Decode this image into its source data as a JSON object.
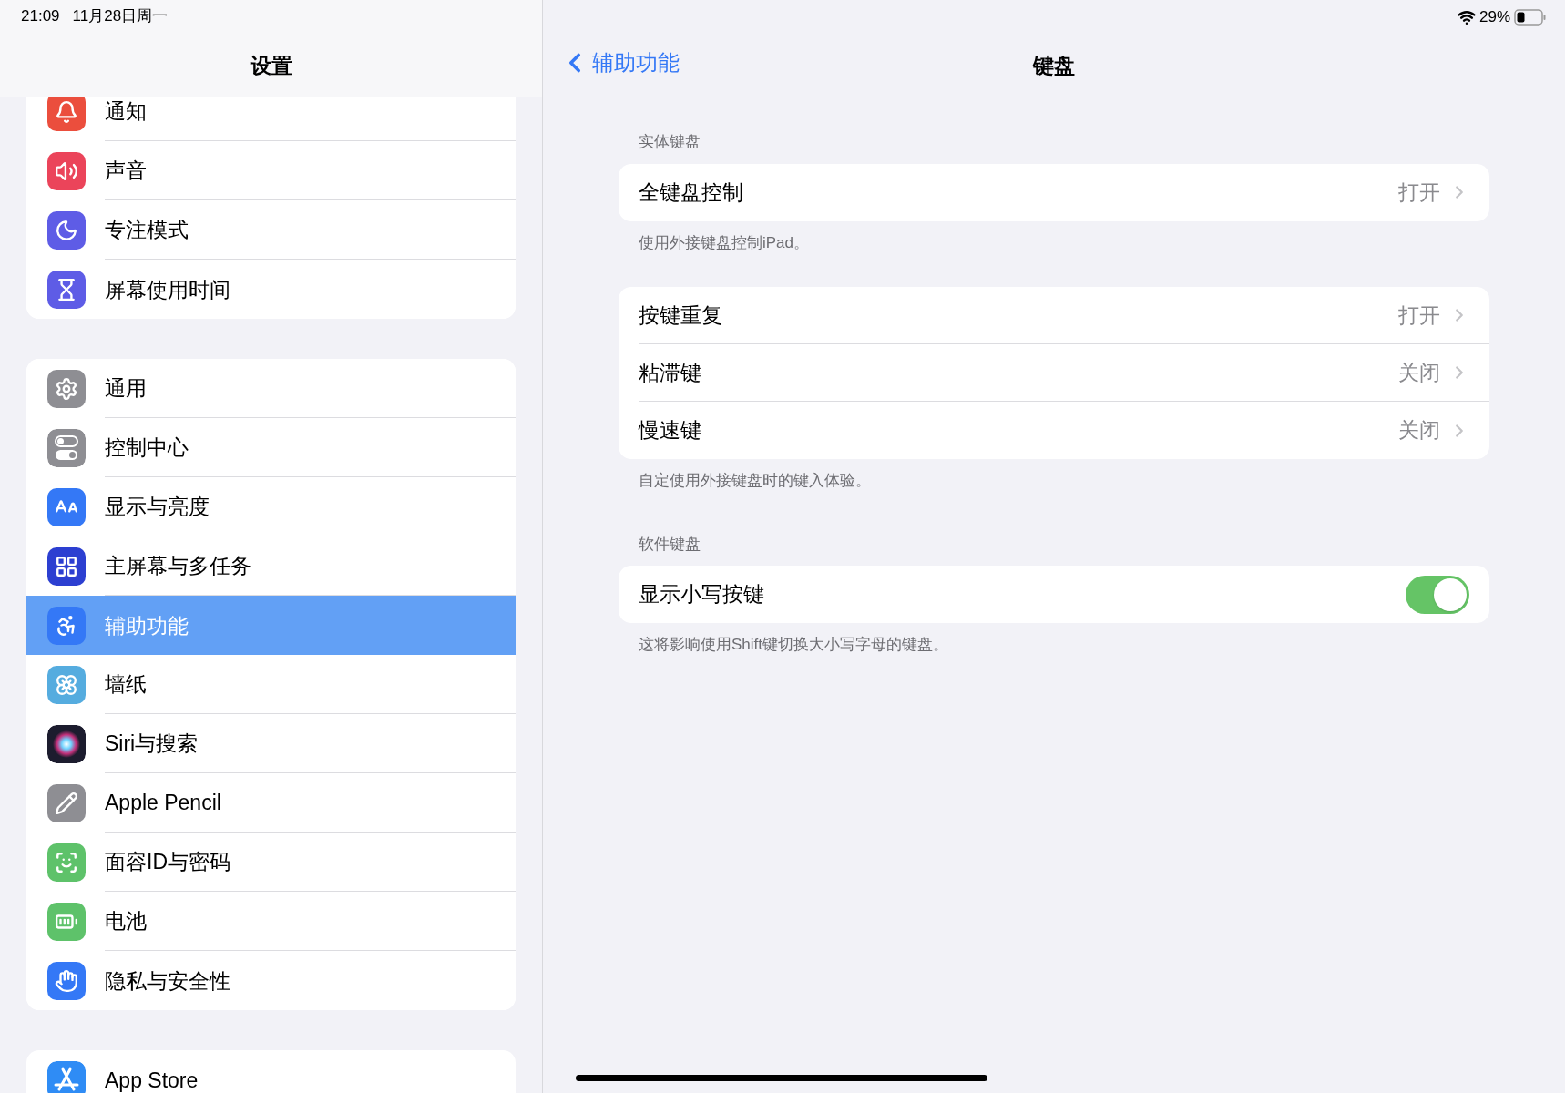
{
  "status_bar": {
    "time": "21:09",
    "date": "11月28日周一",
    "battery": "29%"
  },
  "sidebar": {
    "title": "设置",
    "groups": [
      {
        "items": [
          {
            "kind": "bell",
            "label": "通知",
            "color": "#eb4e3d",
            "selected": false
          },
          {
            "kind": "sound",
            "label": "声音",
            "color": "#eb445a",
            "selected": false
          },
          {
            "kind": "moon",
            "label": "专注模式",
            "color": "#5e5ce6",
            "selected": false
          },
          {
            "kind": "hourglass",
            "label": "屏幕使用时间",
            "color": "#5e5ce6",
            "selected": false
          }
        ]
      },
      {
        "items": [
          {
            "kind": "gear",
            "label": "通用",
            "color": "#8e8e93",
            "selected": false
          },
          {
            "kind": "toggles",
            "label": "控制中心",
            "color": "#8e8e93",
            "selected": false
          },
          {
            "kind": "text-size",
            "label": "显示与亮度",
            "color": "#3478f6",
            "selected": false
          },
          {
            "kind": "grid",
            "label": "主屏幕与多任务",
            "color": "#2c3fd1",
            "selected": false
          },
          {
            "kind": "accessibility",
            "label": "辅助功能",
            "color": "#3478f6",
            "selected": true
          },
          {
            "kind": "flower",
            "label": "墙纸",
            "color": "#55acdf",
            "selected": false
          },
          {
            "kind": "siri",
            "label": "Siri与搜索",
            "color": "#1c1c2e",
            "selected": false
          },
          {
            "kind": "pencil",
            "label": "Apple Pencil",
            "color": "#8e8e93",
            "selected": false
          },
          {
            "kind": "faceid",
            "label": "面容ID与密码",
            "color": "#5ec26a",
            "selected": false
          },
          {
            "kind": "battery",
            "label": "电池",
            "color": "#5ec26a",
            "selected": false
          },
          {
            "kind": "hand",
            "label": "隐私与安全性",
            "color": "#3478f6",
            "selected": false
          }
        ]
      },
      {
        "items": [
          {
            "kind": "appstore",
            "label": "App Store",
            "color": "#2f8cf5",
            "selected": false
          }
        ]
      }
    ]
  },
  "detail": {
    "back": "辅助功能",
    "title": "键盘",
    "sections": [
      {
        "header": "实体键盘",
        "rows": [
          {
            "kind": "link",
            "label": "全键盘控制",
            "value": "打开"
          }
        ],
        "footer": "使用外接键盘控制iPad。"
      },
      {
        "rows": [
          {
            "kind": "link",
            "label": "按键重复",
            "value": "打开"
          },
          {
            "kind": "link",
            "label": "粘滞键",
            "value": "关闭"
          },
          {
            "kind": "link",
            "label": "慢速键",
            "value": "关闭"
          }
        ],
        "footer": "自定使用外接键盘时的键入体验。"
      },
      {
        "header": "软件键盘",
        "rows": [
          {
            "kind": "toggle",
            "label": "显示小写按键",
            "on": true
          }
        ],
        "footer": "这将影响使用Shift键切换大小写字母的键盘。"
      }
    ]
  }
}
